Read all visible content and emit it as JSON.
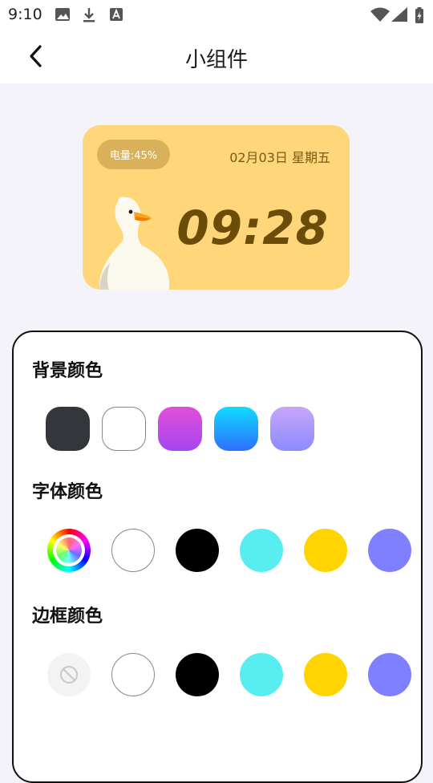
{
  "status_bar": {
    "time": "9:10"
  },
  "header": {
    "title": "小组件"
  },
  "widget_preview": {
    "battery": "电量:45%",
    "date": "02月03日 星期五",
    "time": "09:28"
  },
  "sections": {
    "background": {
      "title": "背景颜色"
    },
    "font": {
      "title": "字体颜色"
    },
    "border": {
      "title": "边框颜色"
    }
  },
  "colors": {
    "widget_bg": "#ffd67a",
    "badge_bg": "#d9b15a",
    "time_color": "#6b4c08",
    "bg_swatches": [
      "#33373b",
      "#ffffff",
      "#e24fd8→#a445f0",
      "#0fdcff→#2f6dff",
      "#c7a6f9→#8b8bff"
    ],
    "font_swatches": [
      "rainbow",
      "#ffffff",
      "#000000",
      "#58eef1",
      "#ffd400",
      "#7f80ff"
    ],
    "border_swatches": [
      "none",
      "#ffffff",
      "#000000",
      "#58eef1",
      "#ffd400",
      "#7f80ff"
    ]
  }
}
